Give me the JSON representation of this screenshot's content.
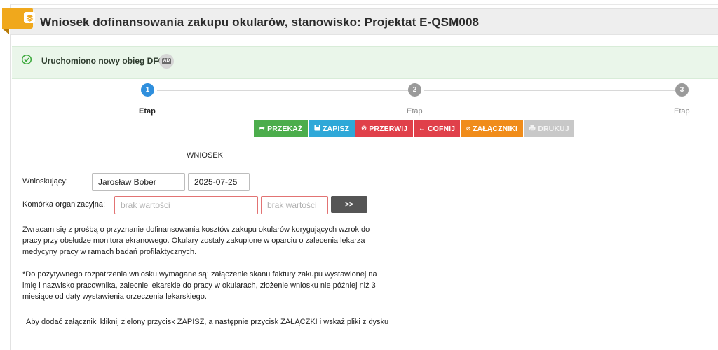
{
  "header": {
    "title": "Wniosek dofinansowania zakupu okularów, stanowisko: Projektat E-QSM008",
    "icon": "layers-icon",
    "accent_color": "#f0a81c"
  },
  "alert": {
    "text": "Uruchomiono nowy obieg DFC",
    "badge": "AD",
    "icon": "check-circle-icon",
    "color": "#3aa83a"
  },
  "steps": [
    {
      "number": "1",
      "label": "Etap",
      "state": "active"
    },
    {
      "number": "2",
      "label": "Etap",
      "state": "pending"
    },
    {
      "number": "3",
      "label": "Etap",
      "state": "pending"
    }
  ],
  "actions": [
    {
      "label": "PRZEKAŻ",
      "icon": "share-icon",
      "color": "#4cad4c"
    },
    {
      "label": "ZAPISZ",
      "icon": "save-icon",
      "color": "#2fa8d8"
    },
    {
      "label": "PRZERWIJ",
      "icon": "ban-icon",
      "color": "#e0404a"
    },
    {
      "label": "COFNIJ",
      "icon": "arrow-left-icon",
      "color": "#e0404a"
    },
    {
      "label": "ZAŁĄCZNIKI",
      "icon": "paperclip-icon",
      "color": "#f08c1a"
    },
    {
      "label": "DRUKUJ",
      "icon": "print-icon",
      "color": "#c8c8c8"
    }
  ],
  "form": {
    "section_title": "WNIOSEK",
    "applicant_label": "Wnioskujący:",
    "applicant_name": "Jarosław Bober",
    "date": "2025-07-25",
    "org_unit_label": "Komórka organizacyjna:",
    "org_unit_placeholder": "brak wartości",
    "org_unit_code_placeholder": "brak wartości",
    "more_button": ">>"
  },
  "text": {
    "request_lines": [
      "Zwracam się z prośbą o przyznanie dofinansowania kosztów zakupu okularów korygujących wzrok do",
      "pracy przy obsłudze monitora ekranowego. Okulary zostały zakupione w oparciu o zalecenia lekarza",
      "medycyny pracy w ramach badań profilaktycznych."
    ],
    "requirements_lines": [
      "*Do pozytywnego rozpatrzenia wniosku wymagane są: załączenie skanu faktury zakupu wystawionej na",
      "imię i nazwisko pracownika, zalecnie lekarskie do pracy w okularach, złożenie wniosku nie później niż 3",
      "miesiące od daty wystawienia orzeczenia lekarskiego."
    ],
    "attachment_hint": "Aby dodać załączniki kliknij zielony przycisk ZAPISZ, a następnie przycisk ZAŁĄCZKI i wskaż pliki z dysku"
  }
}
